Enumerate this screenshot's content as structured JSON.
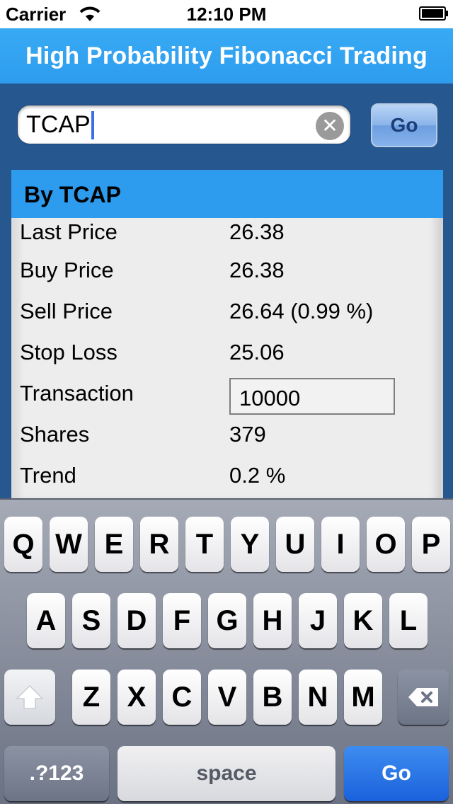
{
  "status_bar": {
    "carrier": "Carrier",
    "time": "12:10 PM"
  },
  "header": {
    "title": "High Probability Fibonacci Trading"
  },
  "search": {
    "value": "TCAP",
    "go_label": "Go"
  },
  "results": {
    "heading": "By TCAP",
    "rows": [
      {
        "label": "Last Price",
        "value": "26.38"
      },
      {
        "label": "Buy Price",
        "value": "26.38"
      },
      {
        "label": "Sell Price",
        "value": "26.64 (0.99 %)"
      },
      {
        "label": "Stop Loss",
        "value": "25.06"
      },
      {
        "label": "Transaction",
        "value": "10000"
      },
      {
        "label": "Shares",
        "value": "379"
      },
      {
        "label": "Trend",
        "value": "0.2 %"
      }
    ]
  },
  "keyboard": {
    "row1": [
      "Q",
      "W",
      "E",
      "R",
      "T",
      "Y",
      "U",
      "I",
      "O",
      "P"
    ],
    "row2": [
      "A",
      "S",
      "D",
      "F",
      "G",
      "H",
      "J",
      "K",
      "L"
    ],
    "row3": [
      "Z",
      "X",
      "C",
      "V",
      "B",
      "N",
      "M"
    ],
    "numbers_label": ".?123",
    "space_label": "space",
    "go_label": "Go"
  },
  "colors": {
    "title_bar": "#2d9cee",
    "background": "#27578f",
    "card": "#ededed",
    "go_key": "#1a62dc"
  }
}
